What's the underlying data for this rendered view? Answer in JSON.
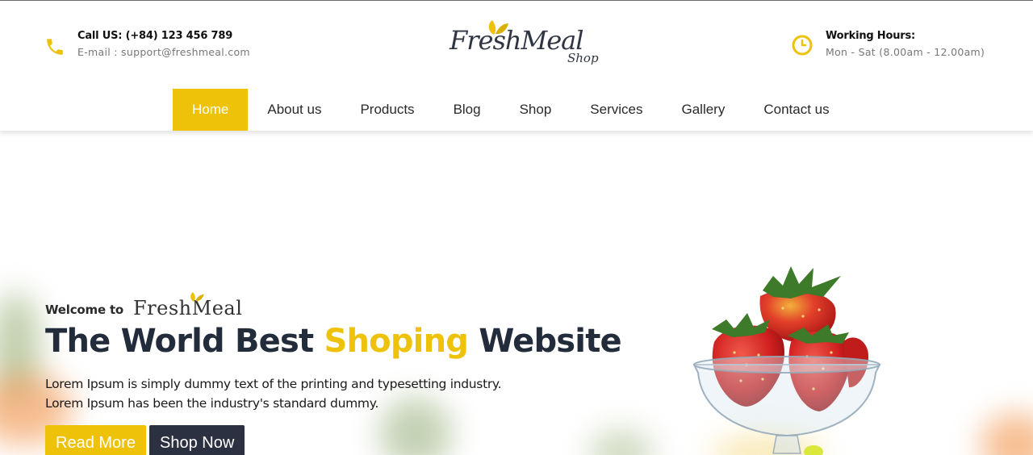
{
  "header": {
    "contact": {
      "call": "Call US: (+84) 123 456 789",
      "email": "E-mail : support@freshmeal.com"
    },
    "logo": {
      "main": "FreshMeal",
      "sub": "Shop"
    },
    "hours": {
      "title": "Working Hours:",
      "value": "Mon - Sat (8.00am - 12.00am)"
    }
  },
  "nav": {
    "items": [
      {
        "label": "Home"
      },
      {
        "label": "About us"
      },
      {
        "label": "Products"
      },
      {
        "label": "Blog"
      },
      {
        "label": "Shop"
      },
      {
        "label": "Services"
      },
      {
        "label": "Gallery"
      },
      {
        "label": "Contact us"
      }
    ]
  },
  "hero": {
    "welcome": "Welcome to",
    "brand": "FreshMeal",
    "headline_before": "The World Best ",
    "headline_accent": "Shoping",
    "headline_after": " Website",
    "desc_line1": "Lorem Ipsum is simply dummy text of the printing and typesetting industry.",
    "desc_line2": "Lorem Ipsum has been the industry's standard dummy.",
    "read_more": "Read More",
    "shop_now": "Shop Now"
  },
  "icons": {
    "phone": "phone-icon",
    "clock": "clock-icon",
    "leaf": "leaf-icon"
  },
  "colors": {
    "accent": "#eec209",
    "dark": "#232c3b",
    "button_dark": "#2b3140"
  }
}
